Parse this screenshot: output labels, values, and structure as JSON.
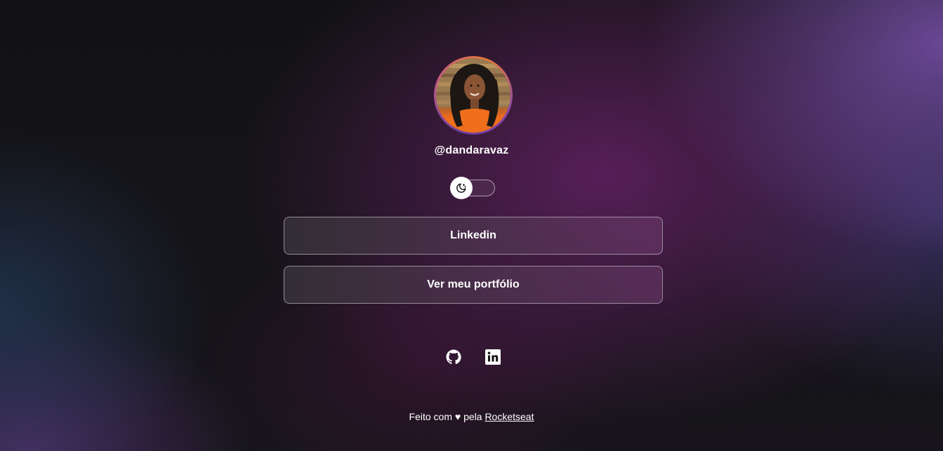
{
  "profile": {
    "handle": "@dandaravaz",
    "avatar_alt": "profile photo"
  },
  "theme_switch": {
    "mode": "dark",
    "knob_icon": "moon-icon"
  },
  "links": [
    {
      "label": "Linkedin"
    },
    {
      "label": "Ver meu portfólio"
    }
  ],
  "social": [
    {
      "icon": "github-icon"
    },
    {
      "icon": "linkedin-icon"
    }
  ],
  "footer": {
    "prefix": "Feito com",
    "heart": "♥",
    "middle": "pela",
    "link_label": "Rocketseat"
  },
  "colors": {
    "background": "#121214",
    "accent_purple": "#6b3fa0",
    "accent_orange": "#e8783a",
    "text": "#ffffff"
  }
}
